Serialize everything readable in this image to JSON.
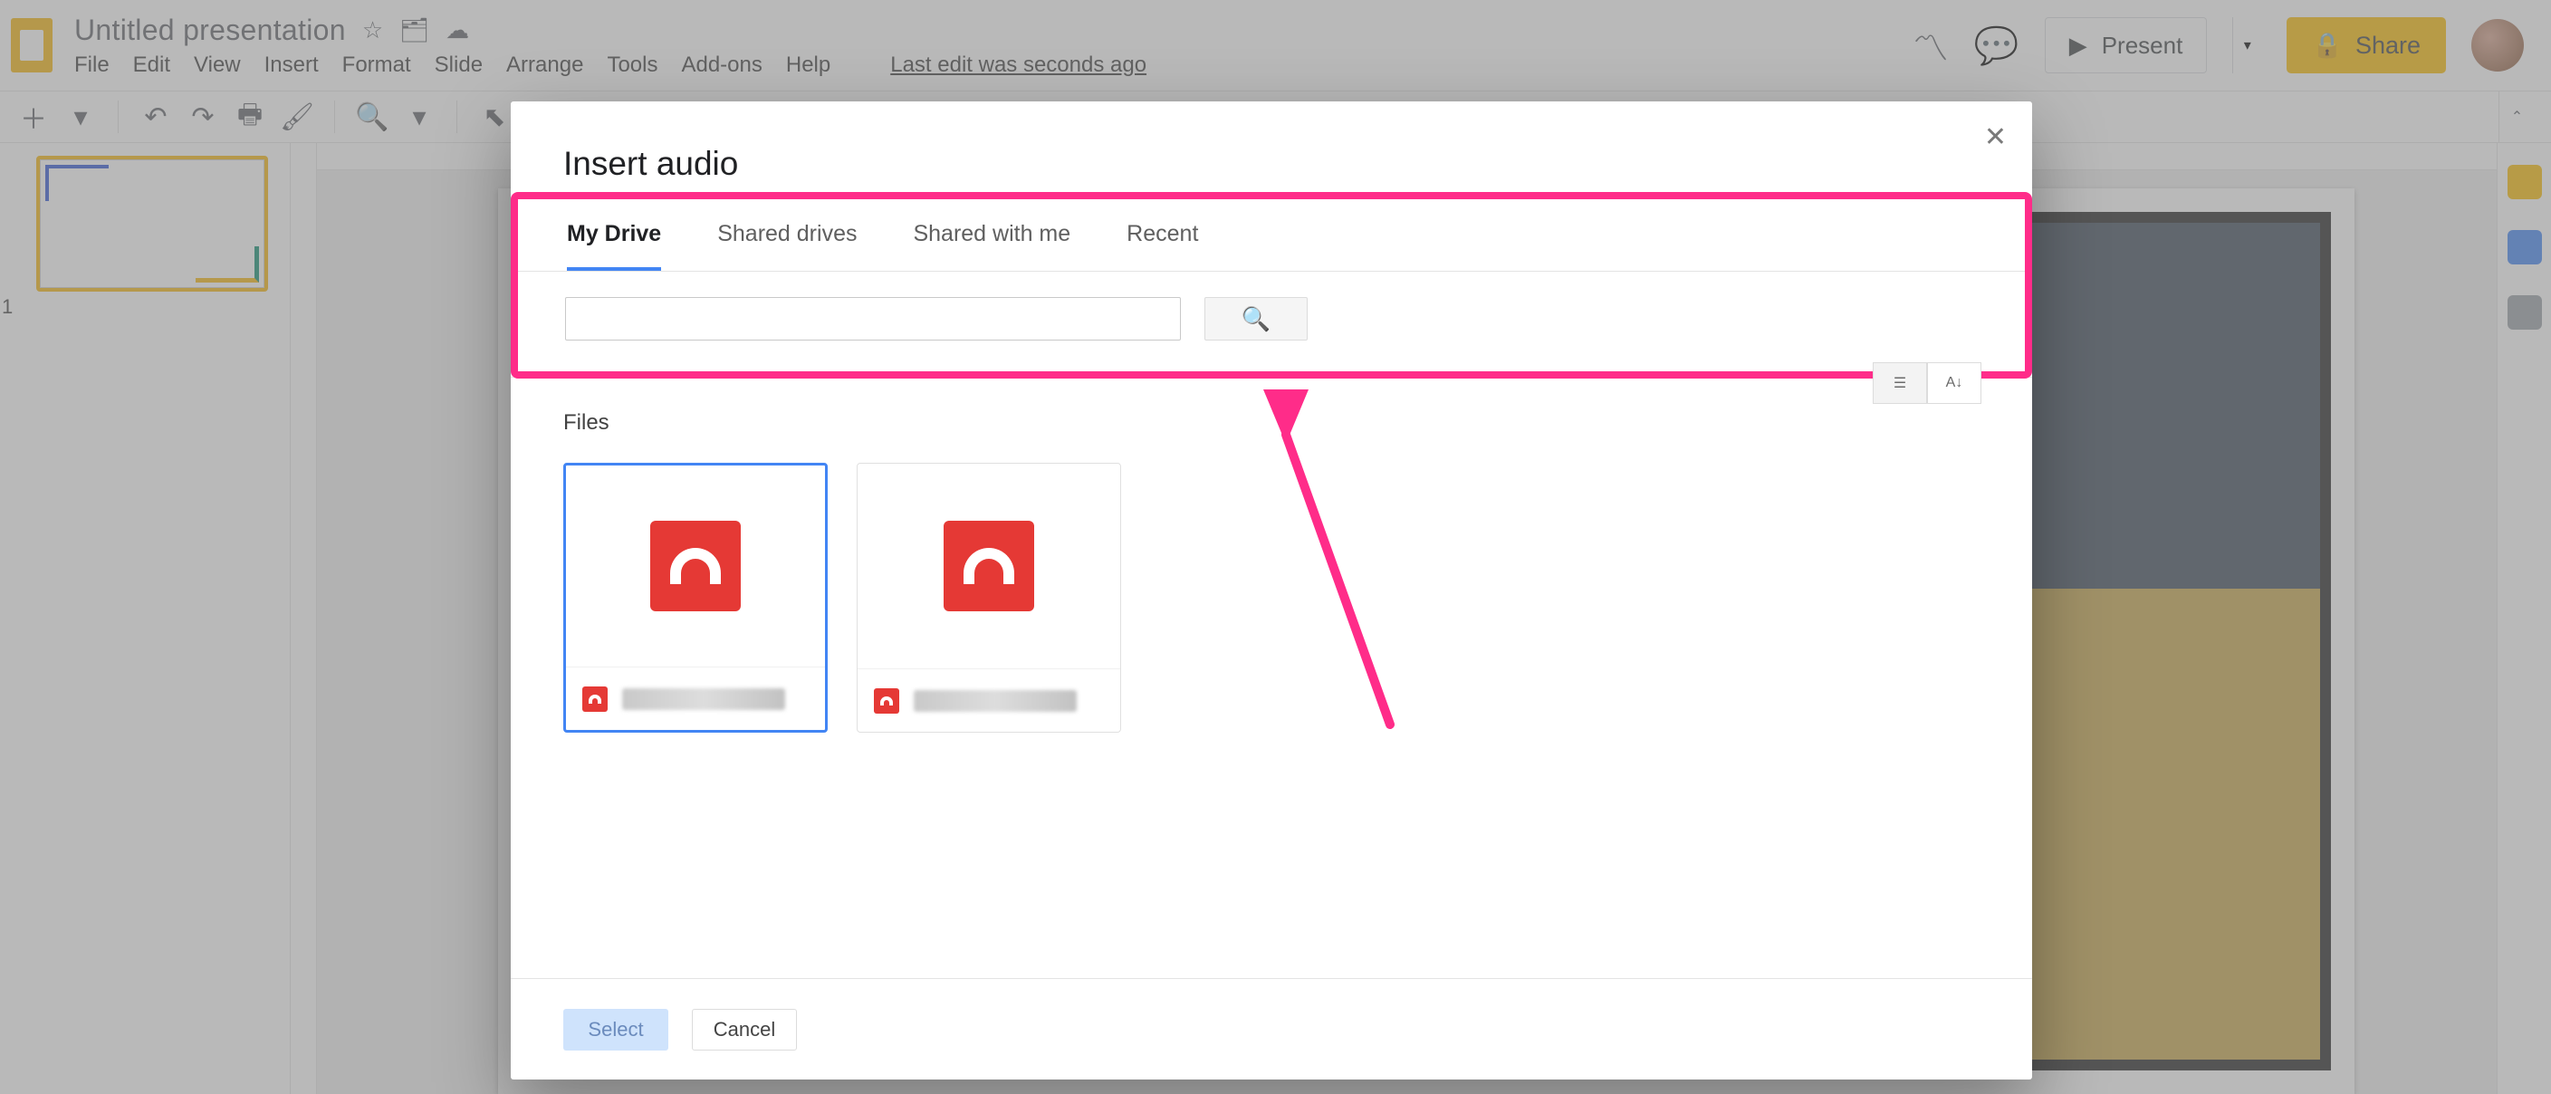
{
  "doc": {
    "title": "Untitled presentation"
  },
  "menus": {
    "file": "File",
    "edit": "Edit",
    "view": "View",
    "insert": "Insert",
    "format": "Format",
    "slide": "Slide",
    "arrange": "Arrange",
    "tools": "Tools",
    "addons": "Add-ons",
    "help": "Help"
  },
  "last_edit": "Last edit was seconds ago",
  "present": {
    "label": "Present"
  },
  "share": {
    "label": "Share"
  },
  "dialog": {
    "title": "Insert audio",
    "tabs": {
      "my_drive": "My Drive",
      "shared_drives": "Shared drives",
      "shared_with_me": "Shared with me",
      "recent": "Recent"
    },
    "search_placeholder": "",
    "files_label": "Files",
    "select_label": "Select",
    "cancel_label": "Cancel"
  },
  "thumb": {
    "number": "1"
  }
}
